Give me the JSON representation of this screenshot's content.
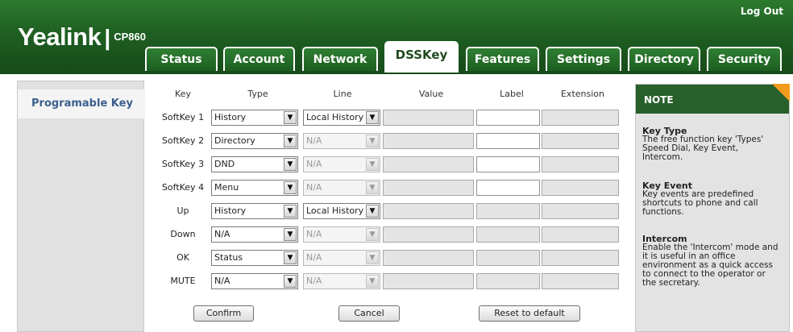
{
  "header": {
    "brand": "Yealink",
    "model": "CP860",
    "logout_label": "Log Out"
  },
  "tabs": [
    {
      "label": "Status"
    },
    {
      "label": "Account"
    },
    {
      "label": "Network"
    },
    {
      "label": "DSSKey"
    },
    {
      "label": "Features"
    },
    {
      "label": "Settings"
    },
    {
      "label": "Directory"
    },
    {
      "label": "Security"
    }
  ],
  "active_tab": "DSSKey",
  "sidebar": {
    "items": [
      {
        "label": "Programable Key"
      }
    ]
  },
  "table": {
    "columns": [
      "Key",
      "Type",
      "Line",
      "Value",
      "Label",
      "Extension"
    ],
    "rows": [
      {
        "key": "SoftKey 1",
        "type": "History",
        "line": "Local History",
        "line_enabled": true,
        "label_enabled": true
      },
      {
        "key": "SoftKey 2",
        "type": "Directory",
        "line": "N/A",
        "line_enabled": false,
        "label_enabled": true
      },
      {
        "key": "SoftKey 3",
        "type": "DND",
        "line": "N/A",
        "line_enabled": false,
        "label_enabled": true
      },
      {
        "key": "SoftKey 4",
        "type": "Menu",
        "line": "N/A",
        "line_enabled": false,
        "label_enabled": true
      },
      {
        "key": "Up",
        "type": "History",
        "line": "Local History",
        "line_enabled": true,
        "label_enabled": false
      },
      {
        "key": "Down",
        "type": "N/A",
        "line": "N/A",
        "line_enabled": false,
        "label_enabled": false
      },
      {
        "key": "OK",
        "type": "Status",
        "line": "N/A",
        "line_enabled": false,
        "label_enabled": false
      },
      {
        "key": "MUTE",
        "type": "N/A",
        "line": "N/A",
        "line_enabled": false,
        "label_enabled": false
      }
    ]
  },
  "buttons": {
    "confirm": "Confirm",
    "cancel": "Cancel",
    "reset": "Reset to default"
  },
  "note": {
    "title": "NOTE",
    "sections": [
      {
        "title": "Key Type",
        "lines": [
          "The free function key 'Types'",
          "Speed Dial, Key Event,",
          "Intercom."
        ]
      },
      {
        "title": "Key Event",
        "lines": [
          "Key events are predefined",
          "shortcuts to phone and call",
          "functions."
        ]
      },
      {
        "title": "Intercom",
        "lines": [
          "Enable the 'Intercom' mode and",
          "it is useful in an office",
          "environment as a quick access",
          "to connect to the operator or",
          "the secretary."
        ]
      }
    ]
  },
  "colors": {
    "header_green": "#1f5f22",
    "note_header": "#27602a",
    "note_corner": "#f39a1d",
    "sidebar_text": "#3b5f8c"
  },
  "icons": {
    "dropdown": "chevron-down-icon"
  }
}
